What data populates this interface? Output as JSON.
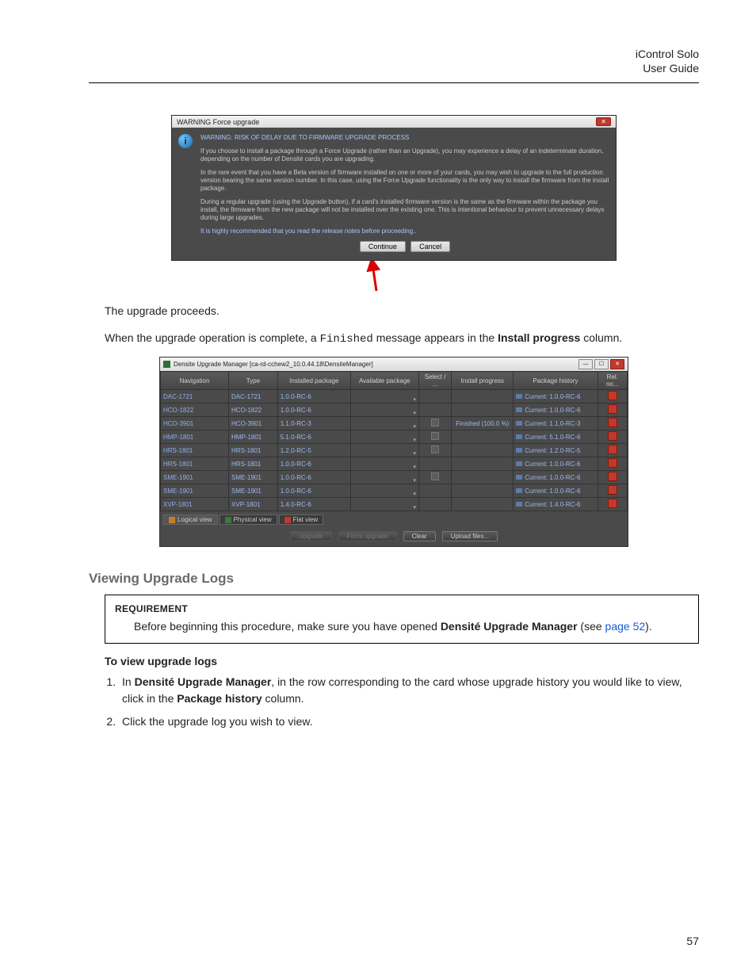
{
  "header": {
    "product": "iControl Solo",
    "doc": "User Guide"
  },
  "warning": {
    "title": "WARNING Force upgrade",
    "heading": "WARNING: RISK OF DELAY DUE TO FIRMWARE UPGRADE PROCESS",
    "p1": "If you choose to install a package through a Force Upgrade (rather than an Upgrade), you may experience a delay of an indeterminate duration, depending on the number of Densité cards you are upgrading.",
    "p2": "In the rare event that you have a Beta version of firmware installed on one or more of your cards, you may wish to upgrade to the full production version bearing the same version number. In this case, using the Force Upgrade functionality is the only way to install the firmware from the install package.",
    "p3": "During a regular upgrade (using the Upgrade button), if a card's installed firmware version is the same as the firmware within the package you install, the firmware from the new package will not be installed over the existing one. This is intentional behaviour to prevent unnecessary delays during large upgrades.",
    "p4": "It is highly recommended that you read the release notes before proceeding..",
    "continue": "Continue",
    "cancel": "Cancel"
  },
  "text": {
    "proceeds": "The upgrade proceeds.",
    "complete_pre": "When the upgrade operation is complete, a ",
    "complete_code": "Finished",
    "complete_mid": " message appears in the ",
    "complete_bold": "Install progress",
    "complete_post": " column."
  },
  "mgr": {
    "title": "Densite Upgrade Manager [ca-rd-cchew2_10.0.44.18\\DensiteManager]",
    "cols": [
      "Navigation",
      "Type",
      "Installed package",
      "Available package",
      "Select / ...",
      "Install progress",
      "Package history",
      "Rel. no..."
    ],
    "rows": [
      {
        "nav": "DAC-1721",
        "type": "DAC-1721",
        "inst": "1.0.0-RC-6",
        "sel": false,
        "prog": "",
        "hist": "Current: 1.0.0-RC-6"
      },
      {
        "nav": "HCO-1822",
        "type": "HCO-1822",
        "inst": "1.0.0-RC-6",
        "sel": false,
        "prog": "",
        "hist": "Current: 1.0.0-RC-6"
      },
      {
        "nav": "HCO-3901",
        "type": "HCO-3901",
        "inst": "1.1.0-RC-3",
        "sel": true,
        "prog": "Finished (100.0 %)",
        "hist": "Current: 1.1.0-RC-3"
      },
      {
        "nav": "HMP-1801",
        "type": "HMP-1801",
        "inst": "5.1.0-RC-6",
        "sel": true,
        "prog": "",
        "hist": "Current: 5.1.0-RC-6"
      },
      {
        "nav": "HRS-1801",
        "type": "HRS-1801",
        "inst": "1.2.0-RC-5",
        "sel": true,
        "prog": "",
        "hist": "Current: 1.2.0-RC-5"
      },
      {
        "nav": "HRS-1801",
        "type": "HRS-1801",
        "inst": "1.0.0-RC-6",
        "sel": false,
        "prog": "",
        "hist": "Current: 1.0.0-RC-6"
      },
      {
        "nav": "SME-1901",
        "type": "SME-1901",
        "inst": "1.0.0-RC-6",
        "sel": true,
        "prog": "",
        "hist": "Current: 1.0.0-RC-6"
      },
      {
        "nav": "SME-1901",
        "type": "SME-1901",
        "inst": "1.0.0-RC-6",
        "sel": false,
        "prog": "",
        "hist": "Current: 1.0.0-RC-6"
      },
      {
        "nav": "XVP-1801",
        "type": "XVP-1801",
        "inst": "1.4.0-RC-6",
        "sel": false,
        "prog": "",
        "hist": "Current: 1.4.0-RC-6"
      }
    ],
    "tabs": {
      "logical": "Logical view",
      "physical": "Physical view",
      "flat": "Flat view"
    },
    "btns": {
      "upgrade": "Upgrade",
      "force": "Force upgrade",
      "clear": "Clear",
      "upload": "Upload files..."
    }
  },
  "section": {
    "heading": "Viewing Upgrade Logs",
    "req_label": "REQUIREMENT",
    "req_pre": "Before beginning this procedure, make sure you have opened ",
    "req_bold": "Densité Upgrade Manager",
    "req_see_pre": " (see ",
    "req_link": "page 52",
    "req_see_post": ").",
    "proc_heading": "To view upgrade logs",
    "step1_pre": "In ",
    "step1_bold1": "Densité Upgrade Manager",
    "step1_mid": ", in the row corresponding to the card whose upgrade history you would like to view, click in the ",
    "step1_bold2": "Package history",
    "step1_post": " column.",
    "step2": "Click the upgrade log you wish to view."
  },
  "pagenum": "57"
}
